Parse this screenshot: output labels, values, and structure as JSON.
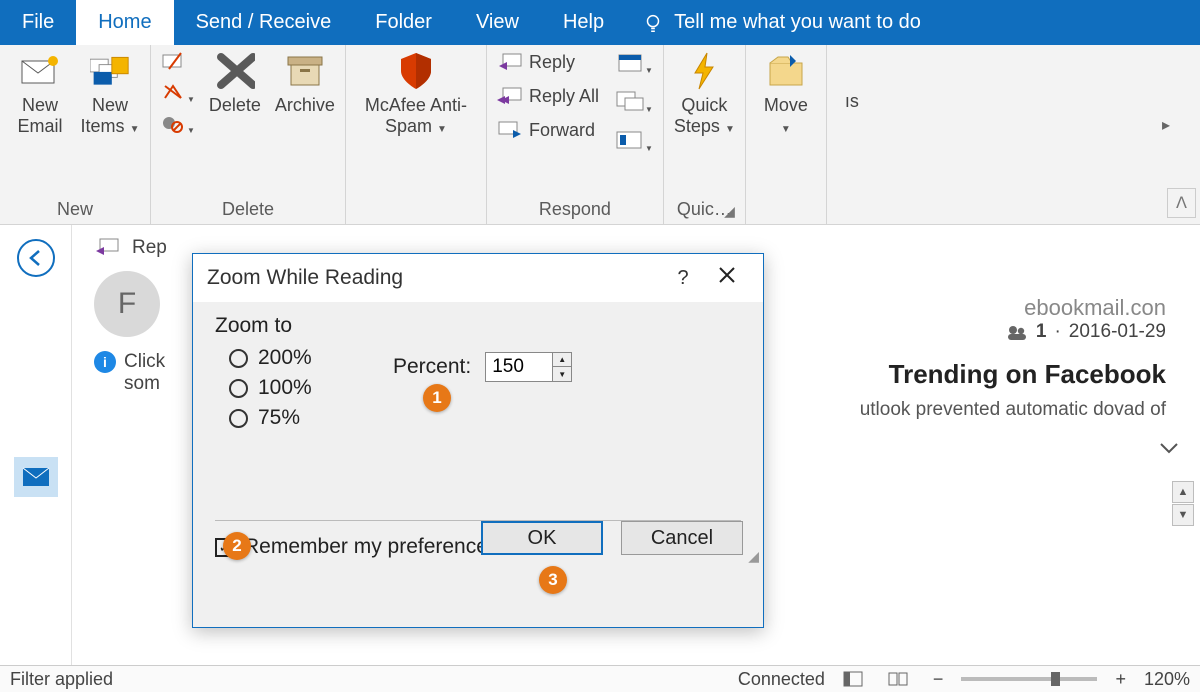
{
  "tabs": {
    "file": "File",
    "home": "Home",
    "send": "Send / Receive",
    "folder": "Folder",
    "view": "View",
    "help": "Help",
    "tellme": "Tell me what you want to do"
  },
  "ribbon": {
    "new_email": "New\nEmail",
    "new_items": "New\nItems",
    "delete": "Delete",
    "archive": "Archive",
    "mcafee": "McAfee Anti-\nSpam",
    "reply": "Reply",
    "reply_all": "Reply All",
    "forward": "Forward",
    "quick_steps": "Quick\nSteps",
    "move": "Move",
    "tags_stub": "ıs",
    "groups": {
      "new": "New",
      "delete": "Delete",
      "respond": "Respond",
      "quick": "Quic…"
    }
  },
  "message": {
    "toolbar_reply": "Rep",
    "avatar_initial": "F",
    "info_prefix": "Click",
    "info_line2": "som",
    "from_domain": "ebookmail.con",
    "count": "1",
    "date": "2016-01-29",
    "subject": "Trending on Facebook",
    "warning": "utlook prevented automatic dovad of"
  },
  "dialog": {
    "title": "Zoom While Reading",
    "zoom_to": "Zoom to",
    "r200": "200%",
    "r100": "100%",
    "r75": "75%",
    "percent_label": "Percent:",
    "percent_value": "150",
    "remember": "Remember my preference",
    "ok": "OK",
    "cancel": "Cancel",
    "callout1": "1",
    "callout2": "2",
    "callout3": "3"
  },
  "status": {
    "filter": "Filter applied",
    "connected": "Connected",
    "zoom": "120%"
  }
}
